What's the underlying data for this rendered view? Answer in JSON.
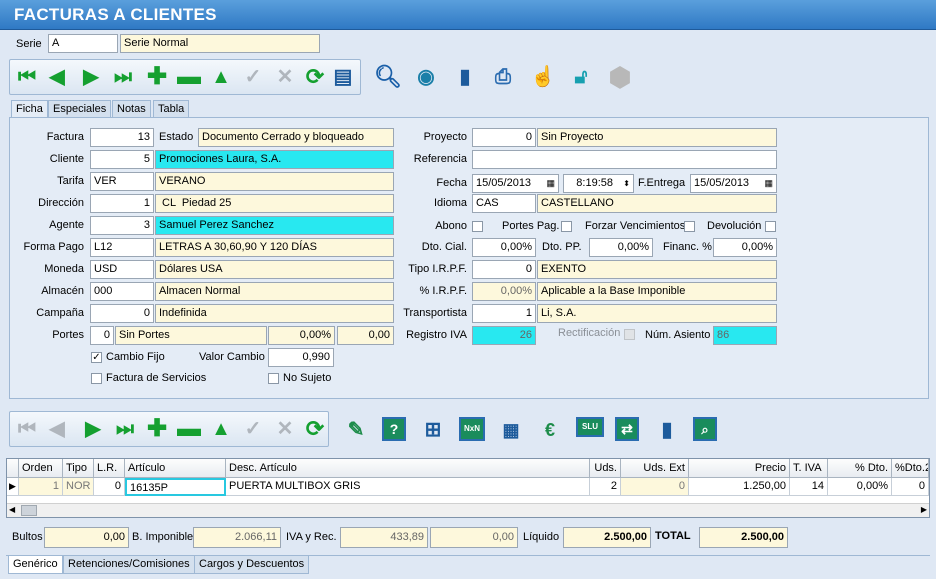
{
  "window": {
    "title": "FACTURAS A CLIENTES"
  },
  "serie": {
    "label": "Serie",
    "code": "A",
    "name": "Serie Normal"
  },
  "tabs": [
    "Ficha",
    "Especiales",
    "Notas",
    "Tabla"
  ],
  "left": {
    "factura_label": "Factura",
    "factura": "13",
    "estado_label": "Estado",
    "estado": "Documento Cerrado y bloqueado",
    "cliente_label": "Cliente",
    "cliente_code": "5",
    "cliente_name": "Promociones Laura, S.A.",
    "tarifa_label": "Tarifa",
    "tarifa_code": "VER",
    "tarifa_name": "VERANO",
    "direccion_label": "Dirección",
    "direccion_code": "1",
    "direccion_name": " CL  Piedad 25",
    "agente_label": "Agente",
    "agente_code": "3",
    "agente_name": "Samuel Perez Sanchez",
    "formapago_label": "Forma Pago",
    "formapago_code": "L12",
    "formapago_name": "LETRAS A 30,60,90 Y 120 DÍAS",
    "moneda_label": "Moneda",
    "moneda_code": "USD",
    "moneda_name": "Dólares USA",
    "almacen_label": "Almacén",
    "almacen_code": "000",
    "almacen_name": "Almacen Normal",
    "campana_label": "Campaña",
    "campana_code": "0",
    "campana_name": "Indefinida",
    "portes_label": "Portes",
    "portes_code": "0",
    "portes_name": "Sin Portes",
    "portes_pct": "0,00%",
    "portes_amt": "0,00",
    "cambio_fijo_label": "Cambio Fijo",
    "cambio_fijo": true,
    "valor_cambio_label": "Valor Cambio",
    "valor_cambio": "0,990",
    "factura_servicios_label": "Factura de Servicios",
    "factura_servicios": false,
    "no_sujeto_label": "No Sujeto",
    "no_sujeto": false
  },
  "right": {
    "proyecto_label": "Proyecto",
    "proyecto_code": "0",
    "proyecto_name": "Sin Proyecto",
    "referencia_label": "Referencia",
    "referencia": "",
    "fecha_label": "Fecha",
    "fecha": "15/05/2013",
    "hora": "8:19:58",
    "fentrega_label": "F.Entrega",
    "fentrega": "15/05/2013",
    "idioma_label": "Idioma",
    "idioma_code": "CAS",
    "idioma_name": "CASTELLANO",
    "abono_label": "Abono",
    "portes_pag_label": "Portes Pag.",
    "forzar_label": "Forzar Vencimientos",
    "devolucion_label": "Devolución",
    "dto_cial_label": "Dto. Cial.",
    "dto_cial": "0,00%",
    "dto_pp_label": "Dto. PP.",
    "dto_pp": "0,00%",
    "financ_label": "Financ. %",
    "financ": "0,00%",
    "tipo_irpf_label": "Tipo I.R.P.F.",
    "tipo_irpf_code": "0",
    "tipo_irpf_name": "EXENTO",
    "pct_irpf_label": "% I.R.P.F.",
    "pct_irpf": "0,00%",
    "pct_irpf_desc": "Aplicable a la Base Imponible",
    "transportista_label": "Transportista",
    "transportista_code": "1",
    "transportista_name": "Li, S.A.",
    "registro_iva_label": "Registro IVA",
    "registro_iva": "26",
    "rectificacion_label": "Rectificación",
    "num_asiento_label": "Núm. Asiento",
    "num_asiento": "86"
  },
  "grid": {
    "headers": [
      "Orden",
      "Tipo",
      "L.R.",
      "Artículo",
      "Desc. Artículo",
      "Uds.",
      "Uds. Ext",
      "Precio",
      "T. IVA",
      "% Dto.",
      "%Dto.2"
    ],
    "rows": [
      {
        "orden": "1",
        "tipo": "NOR",
        "lr": "0",
        "articulo": "16135P",
        "desc": "PUERTA MULTIBOX GRIS",
        "uds": "2",
        "uds_ext": "0",
        "precio": "1.250,00",
        "tiva": "14",
        "dto": "0,00%",
        "dto2": "0"
      }
    ]
  },
  "totals": {
    "bultos_label": "Bultos",
    "bultos": "0,00",
    "bimponible_label": "B. Imponible",
    "bimponible": "2.066,11",
    "iva_label": "IVA y Rec.",
    "iva": "433,89",
    "rec": "0,00",
    "liquido_label": "Líquido",
    "liquido": "2.500,00",
    "total_label": "TOTAL",
    "total": "2.500,00"
  },
  "bottom_tabs": [
    "Genérico",
    "Retenciones/Comisiones",
    "Cargos y Descuentos"
  ],
  "colors": {
    "title_bar": "#3a86d0",
    "accent_cyan": "#28e8f0",
    "readonly_yellow": "#fdf8dc",
    "nav_green": "#15a030"
  },
  "icons": {
    "toolbar1": [
      "first-icon",
      "prev-icon",
      "next-icon",
      "last-icon",
      "add-icon",
      "delete-icon",
      "up-icon",
      "confirm-icon",
      "cancel-icon",
      "refresh-icon",
      "list-icon",
      "search-icon",
      "signal-icon",
      "door-icon",
      "printer-icon",
      "hand-icon",
      "unlock-icon",
      "stop-icon"
    ],
    "toolbar2": [
      "first-icon",
      "prev-icon",
      "next-icon",
      "last-icon",
      "add-icon",
      "delete-icon",
      "up-icon",
      "confirm-icon",
      "cancel-icon",
      "refresh-icon",
      "edit-icon",
      "help-icon",
      "tree-icon",
      "nxn-icon",
      "calculator-icon",
      "currency-icon",
      "slu-icon",
      "transfer-icon",
      "exit-icon",
      "zoom-icon"
    ]
  },
  "toolbar2_labels": {
    "nxn": "NxN",
    "slu": "SLU"
  }
}
